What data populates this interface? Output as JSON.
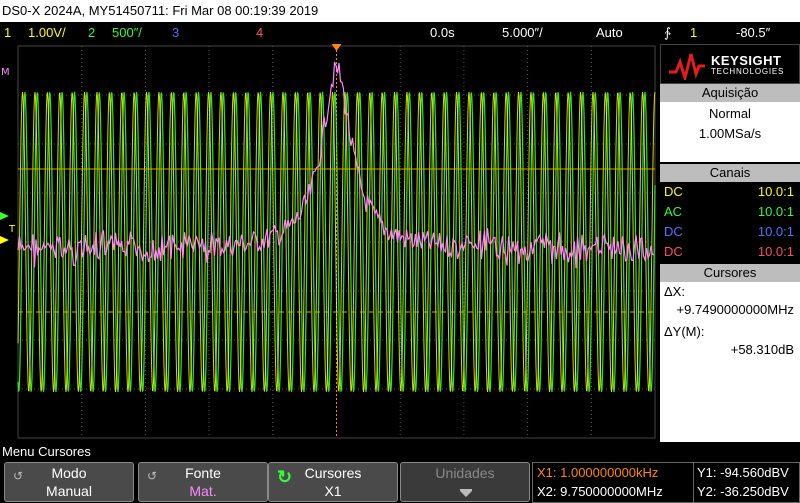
{
  "title": "DS0-X 2024A, MY51450711: Fri Mar 08 00:19:39 2019",
  "top_bar": {
    "ch1_num": "1",
    "ch1_scale": "1.00V/",
    "ch2_num": "2",
    "ch2_scale": "500″/",
    "ch3_num": "3",
    "ch4_num": "4",
    "time_delay": "0.0s",
    "time_scale": "5.000″/",
    "trigger_mode": "Auto",
    "trigger_icon": "∱",
    "trigger_channel": "1",
    "trigger_level": "-80.5″"
  },
  "colors": {
    "ch1": "#ffff00",
    "ch2": "#33ff33",
    "ch3": "#4f73ff",
    "ch4": "#ff4d6e",
    "math": "#ff88ff",
    "grid": "#555555",
    "trigger_marker": "#ff8800"
  },
  "sidebar": {
    "brand": "KEYSIGHT",
    "brand_sub": "TECHNOLOGIES",
    "acquisition": {
      "header": "Aquisição",
      "mode": "Normal",
      "rate": "1.00MSa/s"
    },
    "channels": {
      "header": "Canais",
      "rows": [
        {
          "coupling": "DC",
          "probe": "10.0:1"
        },
        {
          "coupling": "AC",
          "probe": "10.0:1"
        },
        {
          "coupling": "DC",
          "probe": "10.0:1"
        },
        {
          "coupling": "DC",
          "probe": "10.0:1"
        }
      ]
    },
    "cursors": {
      "header": "Cursores",
      "dx_label": "ΔX:",
      "dx_value": "+9.7490000000MHz",
      "dy_label": "ΔY(M):",
      "dy_value": "+58.310dB"
    }
  },
  "bottom": {
    "menu_title": "Menu Cursores",
    "softkeys": [
      {
        "title": "Modo",
        "value": "Manual"
      },
      {
        "title": "Fonte",
        "value": "Mat."
      },
      {
        "title": "Cursores",
        "value": "X1"
      },
      {
        "title": "Unidades",
        "value": ""
      }
    ],
    "readout": {
      "x1": "X1: 1.000000000kHz",
      "x2": "X2: 9.750000000MHz",
      "y1": "Y1: -94.560dBV",
      "y2": "Y2: -36.250dBV"
    }
  }
}
